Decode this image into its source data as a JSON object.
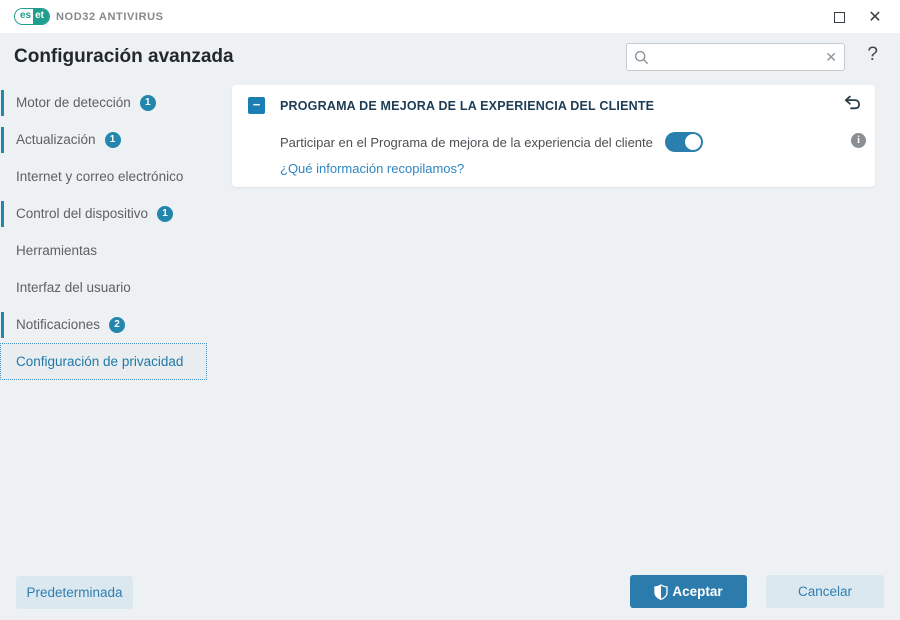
{
  "window": {
    "brand_left": "es",
    "brand_right": "et",
    "title": "NOD32 ANTIVIRUS",
    "close_glyph": "✕"
  },
  "header": {
    "title": "Configuración avanzada",
    "search": {
      "value": "",
      "placeholder": "",
      "clear_glyph": "✕"
    },
    "help_glyph": "?"
  },
  "sidebar": {
    "items": [
      {
        "label": "Motor de detección",
        "badge": "1",
        "marked": true,
        "selected": false
      },
      {
        "label": "Actualización",
        "badge": "1",
        "marked": true,
        "selected": false
      },
      {
        "label": "Internet y correo electrónico",
        "badge": "",
        "marked": false,
        "selected": false
      },
      {
        "label": "Control del dispositivo",
        "badge": "1",
        "marked": true,
        "selected": false
      },
      {
        "label": "Herramientas",
        "badge": "",
        "marked": false,
        "selected": false
      },
      {
        "label": "Interfaz del usuario",
        "badge": "",
        "marked": false,
        "selected": false
      },
      {
        "label": "Notificaciones",
        "badge": "2",
        "marked": true,
        "selected": false
      },
      {
        "label": "Configuración de privacidad",
        "badge": "",
        "marked": false,
        "selected": true
      }
    ]
  },
  "main": {
    "section_title": "PROGRAMA DE MEJORA DE LA EXPERIENCIA DEL CLIENTE",
    "collapse_glyph": "−",
    "toggle": {
      "label": "Participar en el Programa de mejora de la experiencia del cliente",
      "enabled": true
    },
    "info_glyph": "i",
    "link": "¿Qué información recopilamos?"
  },
  "footer": {
    "default_label": "Predeterminada",
    "ok_label": "Aceptar",
    "cancel_label": "Cancelar"
  },
  "colors": {
    "accent": "#2386ad",
    "ok_button": "#2b7cad",
    "link": "#2e86c1",
    "brand_teal": "#1e9e8e",
    "background": "#eef1f3"
  }
}
